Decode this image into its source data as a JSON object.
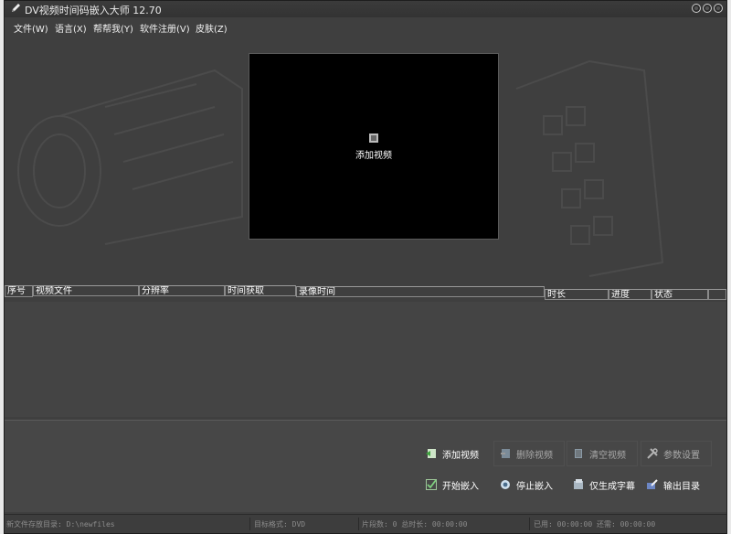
{
  "window": {
    "title": "DV视频时间码嵌入大师  12.70"
  },
  "menu": [
    {
      "label": "文件(W)"
    },
    {
      "label": "语言(X)"
    },
    {
      "label": "帮帮我(Y)"
    },
    {
      "label": "软件注册(V)"
    },
    {
      "label": "皮肤(Z)"
    }
  ],
  "preview": {
    "label": "添加视频"
  },
  "table": {
    "columns": [
      {
        "label": "序号"
      },
      {
        "label": "视频文件"
      },
      {
        "label": "分辨率"
      },
      {
        "label": "时间获取"
      },
      {
        "label": "录像时间"
      },
      {
        "label": "时长"
      },
      {
        "label": "进度"
      },
      {
        "label": "状态"
      }
    ]
  },
  "buttons": {
    "add_video": "添加视频",
    "delete_video": "删除视频",
    "clear_video": "清空视频",
    "settings": "参数设置",
    "start_embed": "开始嵌入",
    "stop_embed": "停止嵌入",
    "subtitle_only": "仅生成字幕",
    "output_dir": "输出目录"
  },
  "status": {
    "save_dir": "新文件存放目录: D:\\newfiles",
    "target_format": "目标格式: DVD",
    "segments": "片段数: 0  总时长: 00:00:00",
    "elapsed": "已用: 00:00:00  还需: 00:00:00"
  },
  "colors": {
    "window_bg": "#3f3f3f",
    "preview_bg": "#000000",
    "text": "#ffffff",
    "disabled_text": "#a8a8a8"
  }
}
